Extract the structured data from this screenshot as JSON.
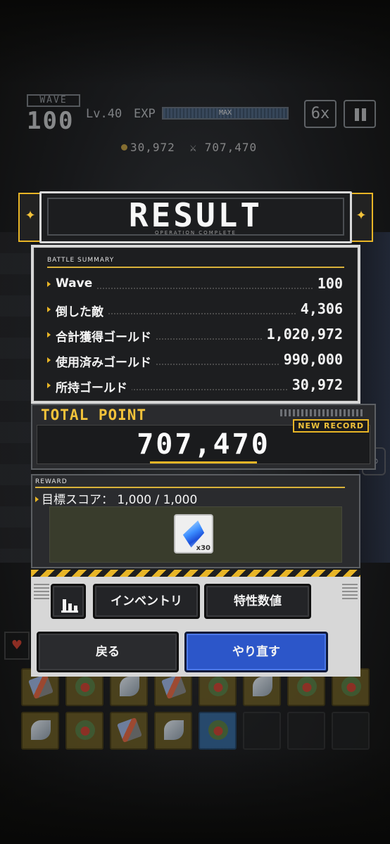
{
  "hud": {
    "wave_label": "WAVE",
    "wave_number": "100",
    "level": "Lv.40",
    "exp_label": "EXP",
    "exp_status": "MAX",
    "speed": "6x"
  },
  "hud_stats": {
    "gold": "30,972",
    "points": "707,470"
  },
  "result": {
    "title": "RESULT",
    "subtitle": "OPERATION COMPLETE",
    "summary_label": "BATTLE SUMMARY",
    "rows": [
      {
        "label": "Wave",
        "value": "100"
      },
      {
        "label": "倒した敵",
        "value": "4,306"
      },
      {
        "label": "合計獲得ゴールド",
        "value": "1,020,972"
      },
      {
        "label": "使用済みゴールド",
        "value": "990,000"
      },
      {
        "label": "所持ゴールド",
        "value": "30,972"
      }
    ],
    "total_label": "TOTAL POINT",
    "new_record": "NEW RECORD",
    "total_value": "707,470",
    "reward_label": "REWARD",
    "reward_target": "目標スコア： 1,000 / 1,000",
    "reward_item": {
      "icon": "crystal-icon",
      "count": "x30"
    },
    "buttons": {
      "inventory": "インベントリ",
      "traits": "特性数値",
      "back": "戻る",
      "retry": "やり直す"
    }
  },
  "colors": {
    "accent_gold": "#e8b526",
    "retry_blue": "#2c56c9",
    "panel_dark": "#1d1e20"
  }
}
